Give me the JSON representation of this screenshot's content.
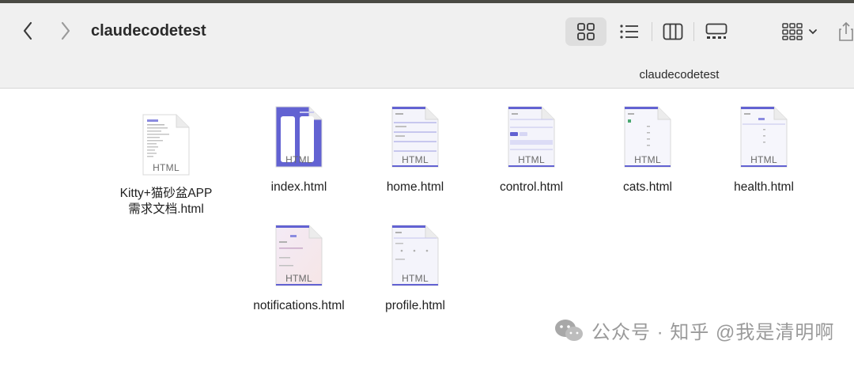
{
  "window": {
    "title": "claudecodetest",
    "path_label": "claudecodetest"
  },
  "toolbar": {
    "back_icon": "chevron-left-icon",
    "forward_icon": "chevron-right-icon",
    "views": [
      {
        "name": "icon-view",
        "icon": "grid-icon",
        "active": true
      },
      {
        "name": "list-view",
        "icon": "list-icon",
        "active": false
      },
      {
        "name": "column-view",
        "icon": "columns-icon",
        "active": false
      },
      {
        "name": "gallery-view",
        "icon": "gallery-icon",
        "active": false
      }
    ],
    "group_icon": "group-by-icon",
    "share_icon": "share-icon"
  },
  "files": [
    {
      "name": "Kitty+猫砂盆APP\n需求文档.html",
      "line1": "Kitty+猫砂盆APP",
      "line2": "需求文档.html",
      "badge": "HTML",
      "thumb": "doc"
    },
    {
      "name": "index.html",
      "line1": "index.html",
      "line2": "",
      "badge": "HTML",
      "thumb": "phones"
    },
    {
      "name": "home.html",
      "line1": "home.html",
      "line2": "",
      "badge": "HTML",
      "thumb": "app"
    },
    {
      "name": "control.html",
      "line1": "control.html",
      "line2": "",
      "badge": "HTML",
      "thumb": "app"
    },
    {
      "name": "cats.html",
      "line1": "cats.html",
      "line2": "",
      "badge": "HTML",
      "thumb": "app"
    },
    {
      "name": "health.html",
      "line1": "health.html",
      "line2": "",
      "badge": "HTML",
      "thumb": "app"
    },
    {
      "name": "notifications.html",
      "line1": "notifications.html",
      "line2": "",
      "badge": "HTML",
      "thumb": "app-pink"
    },
    {
      "name": "profile.html",
      "line1": "profile.html",
      "line2": "",
      "badge": "HTML",
      "thumb": "app"
    }
  ],
  "watermark": {
    "text": "公众号 · 知乎 @我是清明啊",
    "icon": "wechat-icon"
  },
  "colors": {
    "accent": "#5b5bd6",
    "toolbar_bg": "#f0f0f0"
  }
}
